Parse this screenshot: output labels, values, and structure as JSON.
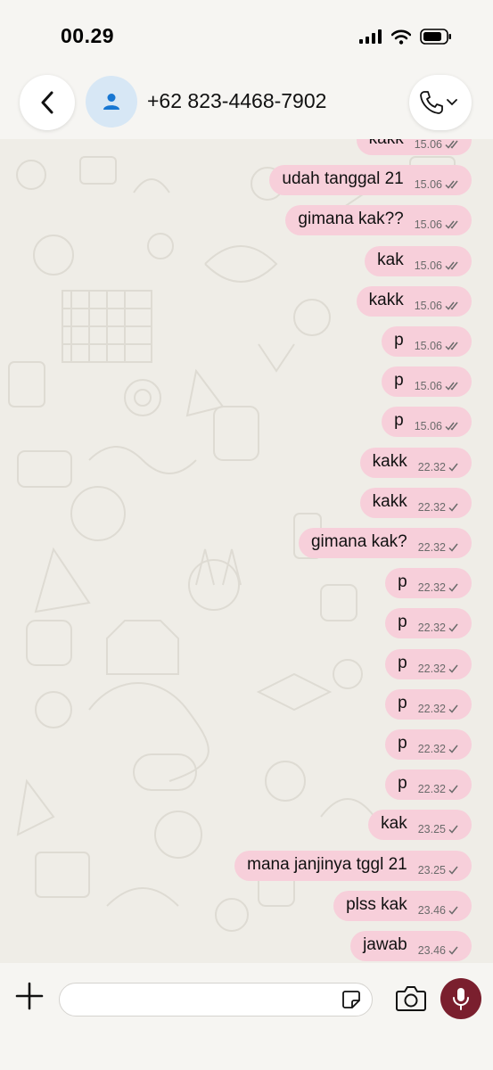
{
  "status_bar": {
    "time": "00.29"
  },
  "header": {
    "contact": "+62 823-4468-7902"
  },
  "messages": [
    {
      "text": "kakk",
      "time": "15.06",
      "status": "read"
    },
    {
      "text": "udah tanggal 21",
      "time": "15.06",
      "status": "read"
    },
    {
      "text": "gimana kak??",
      "time": "15.06",
      "status": "read"
    },
    {
      "text": "kak",
      "time": "15.06",
      "status": "read"
    },
    {
      "text": "kakk",
      "time": "15.06",
      "status": "read"
    },
    {
      "text": "p",
      "time": "15.06",
      "status": "read"
    },
    {
      "text": "p",
      "time": "15.06",
      "status": "read"
    },
    {
      "text": "p",
      "time": "15.06",
      "status": "read"
    },
    {
      "text": "kakk",
      "time": "22.32",
      "status": "sent"
    },
    {
      "text": "kakk",
      "time": "22.32",
      "status": "sent"
    },
    {
      "text": "gimana kak?",
      "time": "22.32",
      "status": "sent"
    },
    {
      "text": "p",
      "time": "22.32",
      "status": "sent"
    },
    {
      "text": "p",
      "time": "22.32",
      "status": "sent"
    },
    {
      "text": "p",
      "time": "22.32",
      "status": "sent"
    },
    {
      "text": "p",
      "time": "22.32",
      "status": "sent"
    },
    {
      "text": "p",
      "time": "22.32",
      "status": "sent"
    },
    {
      "text": "p",
      "time": "22.32",
      "status": "sent"
    },
    {
      "text": "kak",
      "time": "23.25",
      "status": "sent"
    },
    {
      "text": "mana janjinya tggl 21",
      "time": "23.25",
      "status": "sent"
    },
    {
      "text": "plss kak",
      "time": "23.46",
      "status": "sent"
    },
    {
      "text": "jawab",
      "time": "23.46",
      "status": "sent"
    }
  ],
  "input": {
    "placeholder": ""
  },
  "colors": {
    "bubble": "#f7cfda",
    "mic": "#7a1f2e",
    "background": "#efede7",
    "avatar_icon": "#1877d2"
  },
  "icons": [
    "back-icon",
    "person-icon",
    "phone-icon",
    "chevron-down-icon",
    "plus-icon",
    "sticker-icon",
    "camera-icon",
    "mic-icon",
    "signal-icon",
    "wifi-icon",
    "battery-icon"
  ]
}
